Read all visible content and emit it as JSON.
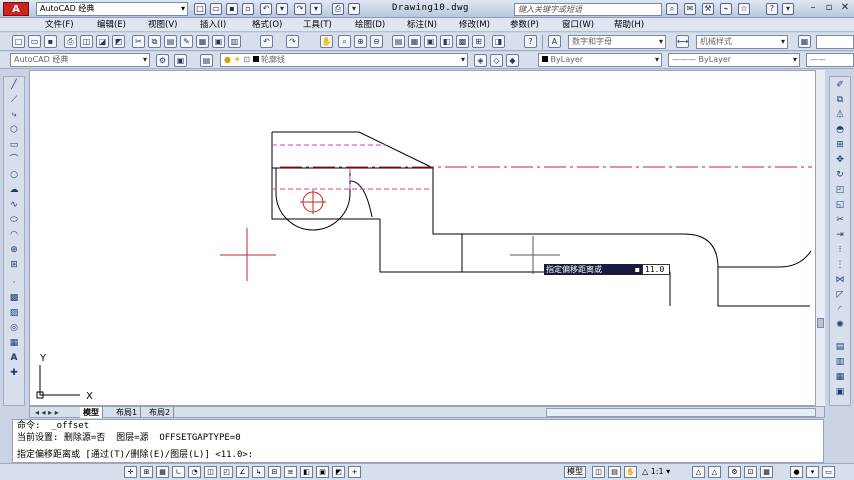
{
  "app": {
    "logo": "A",
    "workspace": "AutoCAD 经典",
    "document_title": "Drawing10.dwg",
    "search_placeholder": "键入关键字或短语"
  },
  "menu": [
    "文件(F)",
    "编辑(E)",
    "视图(V)",
    "插入(I)",
    "格式(O)",
    "工具(T)",
    "绘图(D)",
    "标注(N)",
    "修改(M)",
    "参数(P)",
    "窗口(W)",
    "帮助(H)"
  ],
  "toolbar2": {
    "text_style": "数字和字母",
    "dim_style": "机械样式"
  },
  "toolbar3": {
    "workspace_combo": "AutoCAD 经典",
    "layer_name": "轮廓线",
    "color": "ByLayer",
    "linetype": "ByLayer",
    "lineweight": "ByLayer"
  },
  "dynamic_input": {
    "prompt": "指定偏移距离或",
    "value": "11.0"
  },
  "tabs": [
    "模型",
    "布局1",
    "布局2"
  ],
  "command": {
    "line1": "命令:  _offset",
    "line2": "当前设置: 删除源=否  图层=源  OFFSETGAPTYPE=0",
    "line3": "指定偏移距离或 [通过(T)/删除(E)/图层(L)] <11.0>:"
  },
  "status": {
    "model_label": "模型",
    "scale": "1:1"
  },
  "colors": {
    "drawing_line": "#000000",
    "center_line": "#cc2222",
    "hidden_line": "#cc44aa",
    "crosshair": "#c8202a"
  }
}
